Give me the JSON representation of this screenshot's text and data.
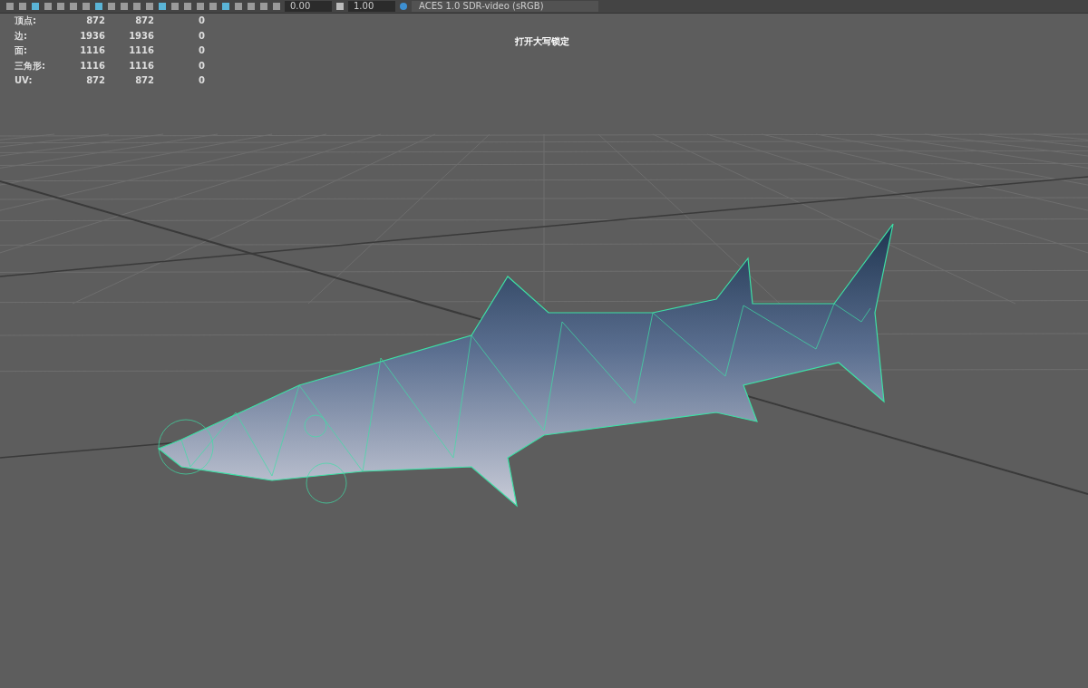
{
  "toolbar": {
    "exposure": "0.00",
    "gamma": "1.00",
    "color_space": "ACES 1.0 SDR-video (sRGB)"
  },
  "stats": [
    {
      "label": "顶点:",
      "values": [
        "872",
        "872",
        "0"
      ]
    },
    {
      "label": "边:",
      "values": [
        "1936",
        "1936",
        "0"
      ]
    },
    {
      "label": "面:",
      "values": [
        "1116",
        "1116",
        "0"
      ]
    },
    {
      "label": "三角形:",
      "values": [
        "1116",
        "1116",
        "0"
      ]
    },
    {
      "label": "UV:",
      "values": [
        "872",
        "872",
        "0"
      ]
    }
  ],
  "viewport_message": "打开大写锁定"
}
